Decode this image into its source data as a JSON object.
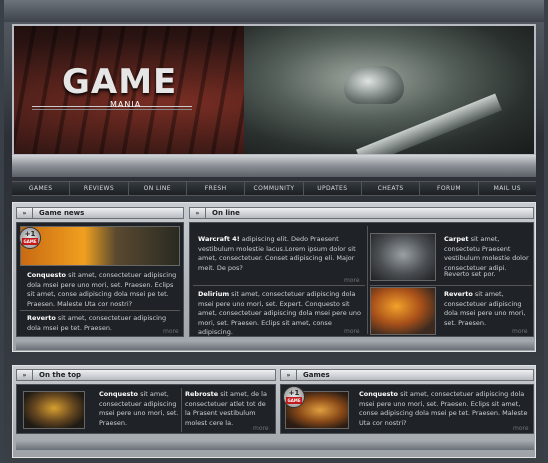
{
  "logo": {
    "title": "GAME",
    "subtitle": "MANIA"
  },
  "nav": [
    "GAMES",
    "REVIEWS",
    "ON LINE",
    "FRESH",
    "COMMUNITY",
    "UPDATES",
    "CHEATS",
    "FORUM",
    "MAIL US"
  ],
  "game_news": {
    "title": "Game news",
    "badge": {
      "num": "+1",
      "label": "GAME"
    },
    "items": [
      {
        "lead": "Conquesto",
        "text": " sit amet, consectetuer adipiscing dola msei pere uno mori, set. Praesen. Eclips sit amet, conse adipiscing dola msei pe tet. Praesen. Maleste Uta cor nostri?"
      },
      {
        "lead": "Reverto",
        "text": " sit amet, consectetuer adipiscing dola msei pe tet. Praesen."
      }
    ],
    "more": "more"
  },
  "online": {
    "title": "On line",
    "items": [
      {
        "lead": "Warcraft 4!",
        "text": " adipiscing elit. Dedo  Praesent vestibulum molestie lacus.Lorem ipsum dolor sit amet, consectetuer. Conset adipiscing eli. Major meit. De pos?",
        "more": "more"
      },
      {
        "lead": "Delirium",
        "text": " sit amet, consectetuer adipiscing dola msei pere uno mori, set. Expert. Conquesto sit amet, consectetuer adipiscing dola msei pere uno mori, set. Praesen. Eclips sit amet, conse adipiscing.",
        "more": "more"
      }
    ],
    "side": [
      {
        "lead": "Carpet",
        "text": " sit amet, consectetu Praesent vestibulum molestie dolor consectetuer adipi.",
        "extra": "Reverto set por."
      },
      {
        "lead": "Reverto",
        "text": " sit amet, consectetuer adipiscing dola msei pere uno mori, set. Praesen.",
        "more": "more"
      }
    ]
  },
  "on_top": {
    "title": "On the top",
    "items": [
      {
        "lead": "Conquesto",
        "text": " sit amet, consectetuer adipiscing msei pere uno mori, set. Praesen."
      },
      {
        "lead": "Rebroste",
        "text": " sit amet, de la consectetuer atlet tot de la Prasent vestibulum molest cere la."
      }
    ],
    "more": "more"
  },
  "games": {
    "title": "Games",
    "badge": {
      "num": "+1",
      "label": "GAME"
    },
    "item": {
      "lead": "Conquesto",
      "text": " sit amet, consectetuer adipiscing dola msei pere uno mori, set. Praesen. Eclips sit amet, conse adipiscing dola msei pe tet. Praesen. Maleste Uta cor nostri?"
    },
    "more": "more"
  }
}
